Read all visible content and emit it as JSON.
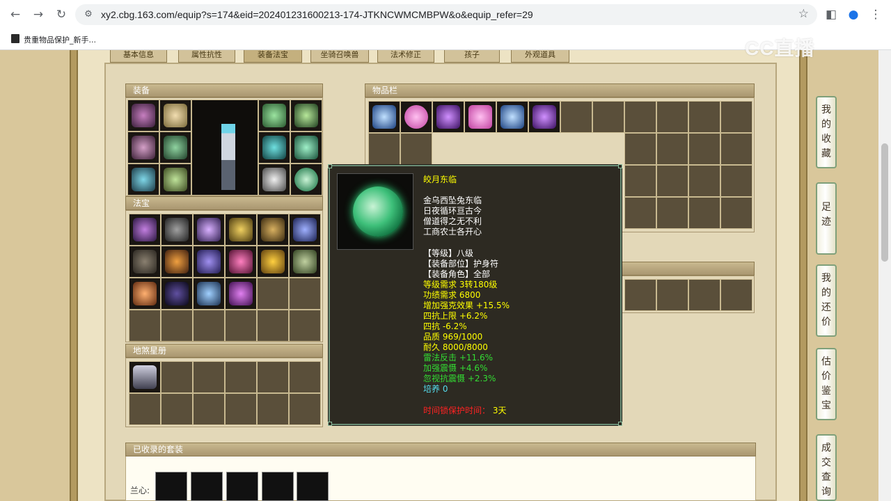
{
  "browser": {
    "url": "xy2.cbg.163.com/equip?s=174&eid=202401231600213-174-JTKNCWMCMBPW&o&equip_refer=29",
    "bookmark": "贵重物品保护_新手...",
    "watermark": "CC直播"
  },
  "tabs": [
    "基本信息",
    "属性抗性",
    "装备法宝",
    "坐骑召唤兽",
    "法术修正",
    "孩子",
    "外观道具"
  ],
  "sections": {
    "equipment": "装备",
    "treasure": "法宝",
    "star_book": "地煞星册",
    "inventory": "物品栏",
    "suits": "已收录的套装"
  },
  "suit_row_label": "兰心:",
  "tooltip": {
    "name": "皎月东临",
    "poem": [
      "金乌西坠兔东临",
      "日夜循环亘古今",
      "僧道得之无不利",
      "工商农士各开心"
    ],
    "basic": [
      "【等级】八级",
      "【装备部位】护身符",
      "【装备角色】全部"
    ],
    "reqs": [
      "等级需求 3转180级",
      "功绩需求 6800",
      "增加强克效果 +15.5%",
      "四抗上限 +6.2%",
      "四抗 -6.2%",
      "品质 969/1000",
      "耐久 8000/8000"
    ],
    "bonus": [
      "雷法反击 +11.6%",
      "加强震慑 +4.6%",
      "忽视抗震慑 +2.3%"
    ],
    "nurture": "培养 0",
    "protect_label": "时间锁保护时间：",
    "protect_value": "3天"
  },
  "sidebar": [
    {
      "label": "我的收藏"
    },
    {
      "label": "足迹"
    },
    {
      "label": "我的还价"
    },
    {
      "label": "估价鉴宝"
    },
    {
      "label": "成交查询"
    }
  ],
  "colors": {
    "yellow": "#ffff00",
    "green": "#33dd33",
    "cyan": "#55ddee",
    "red": "#ff2222"
  }
}
